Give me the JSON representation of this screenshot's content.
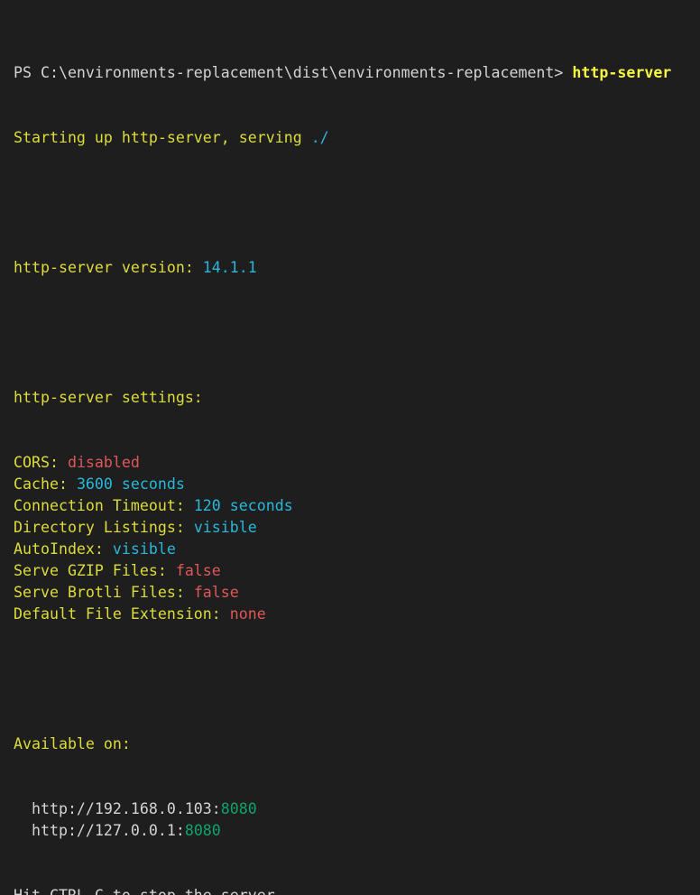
{
  "terminal": {
    "prompt": "PS C:\\environments-replacement\\dist\\environments-replacement> ",
    "command": "http-server",
    "starting_prefix": "Starting up http-server, serving ",
    "serve_path": "./",
    "version_label": "http-server version: ",
    "version_value": "14.1.1",
    "settings_heading": "http-server settings:",
    "settings": [
      {
        "key": "CORS: ",
        "value": "disabled",
        "value_color": "#e05757"
      },
      {
        "key": "Cache: ",
        "value": "3600 seconds",
        "value_color": "#29b8db"
      },
      {
        "key": "Connection Timeout: ",
        "value": "120 seconds",
        "value_color": "#29b8db"
      },
      {
        "key": "Directory Listings: ",
        "value": "visible",
        "value_color": "#29b8db"
      },
      {
        "key": "AutoIndex: ",
        "value": "visible",
        "value_color": "#29b8db"
      },
      {
        "key": "Serve GZIP Files: ",
        "value": "false",
        "value_color": "#e05757"
      },
      {
        "key": "Serve Brotli Files: ",
        "value": "false",
        "value_color": "#e05757"
      },
      {
        "key": "Default File Extension: ",
        "value": "none",
        "value_color": "#e05757"
      }
    ],
    "available_heading": "Available on:",
    "addresses": [
      {
        "host": "  http://192.168.0.103:",
        "port": "8080"
      },
      {
        "host": "  http://127.0.0.1:",
        "port": "8080"
      }
    ],
    "stop_hint": "Hit CTRL-C to stop the server"
  },
  "colors": {
    "background": "#1e1e1e",
    "default_text": "#d4d4d4",
    "yellow": "#dcdc3c",
    "command_yellow": "#f5f543",
    "cyan": "#29b8db",
    "red": "#e05757",
    "green": "#10a36b"
  }
}
